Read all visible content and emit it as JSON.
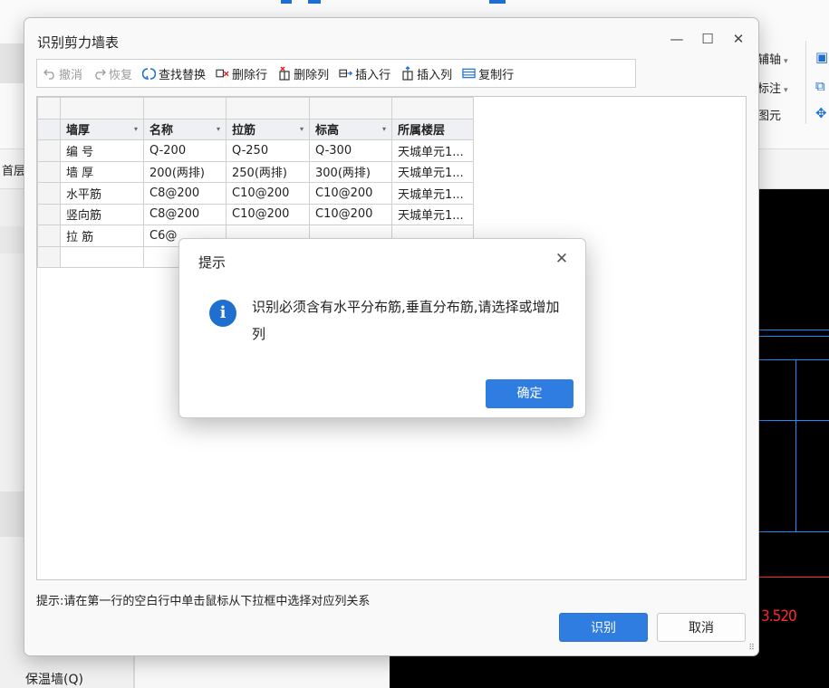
{
  "background": {
    "ribbon_right_items": [
      {
        "label": "辅轴",
        "has_caret": true
      },
      {
        "label": "标注",
        "has_caret": true
      },
      {
        "label": "图元",
        "has_caret": false
      }
    ],
    "left_tab_label": "首层",
    "wall_label": "保温墙(Q)",
    "cad_text": "3.520"
  },
  "dialog": {
    "title": "识别剪力墙表",
    "toolbar": [
      {
        "id": "undo",
        "label": "撤消",
        "icon": "undo-icon",
        "disabled": true
      },
      {
        "id": "redo",
        "label": "恢复",
        "icon": "redo-icon",
        "disabled": true
      },
      {
        "id": "find-replace",
        "label": "查找替换",
        "icon": "find-replace-icon",
        "disabled": false
      },
      {
        "id": "delete-row",
        "label": "删除行",
        "icon": "delete-row-icon",
        "disabled": false
      },
      {
        "id": "delete-col",
        "label": "删除列",
        "icon": "delete-column-icon",
        "disabled": false
      },
      {
        "id": "insert-row",
        "label": "插入行",
        "icon": "insert-row-icon",
        "disabled": false
      },
      {
        "id": "insert-col",
        "label": "插入列",
        "icon": "insert-column-icon",
        "disabled": false
      },
      {
        "id": "copy-row",
        "label": "复制行",
        "icon": "copy-row-icon",
        "disabled": false
      }
    ],
    "table": {
      "header_row": [
        "墙厚",
        "名称",
        "拉筋",
        "标高",
        "所属楼层"
      ],
      "rows": [
        [
          "编 号",
          "Q-200",
          "Q-250",
          "Q-300",
          "天城单元1..."
        ],
        [
          "墙 厚",
          "200(两排)",
          "250(两排)",
          "300(两排)",
          "天城单元1..."
        ],
        [
          "水平筋",
          "C8@200",
          "C10@200",
          "C10@200",
          "天城单元1..."
        ],
        [
          "竖向筋",
          "C8@200",
          "C10@200",
          "C10@200",
          "天城单元1..."
        ],
        [
          "拉 筋",
          "C6@",
          "",
          "",
          ""
        ]
      ]
    },
    "hint": "提示:请在第一行的空白行中单击鼠标从下拉框中选择对应列关系",
    "recognize_button": "识别",
    "cancel_button": "取消"
  },
  "alert": {
    "title": "提示",
    "message": "识别必须含有水平分布筋,垂直分布筋,请选择或增加列",
    "ok_button": "确定",
    "icon": "info-icon"
  },
  "colors": {
    "accent": "#2f7de1",
    "cad_blue": "#1a8fff",
    "cad_red": "#ff2a2a"
  }
}
